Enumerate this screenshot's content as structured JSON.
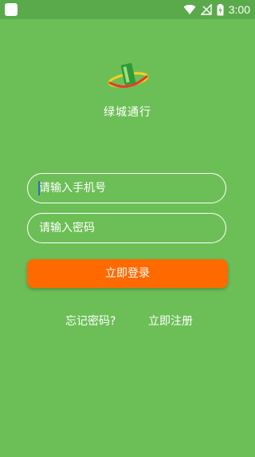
{
  "status_bar": {
    "time": "3:00",
    "icons": [
      "app-notification-icon",
      "wifi-icon",
      "no-signal-icon",
      "battery-charging-icon"
    ]
  },
  "app": {
    "name": "绿城通行",
    "logo_icon": "green-city-logo-icon"
  },
  "login_form": {
    "phone_placeholder": "请输入手机号",
    "password_placeholder": "请输入密码",
    "login_button": "立即登录",
    "forgot_password": "忘记密码?",
    "register": "立即注册"
  },
  "colors": {
    "background": "#6cbf56",
    "status_bar": "#5aa94a",
    "button": "#ff6a00",
    "text": "#ffffff"
  }
}
